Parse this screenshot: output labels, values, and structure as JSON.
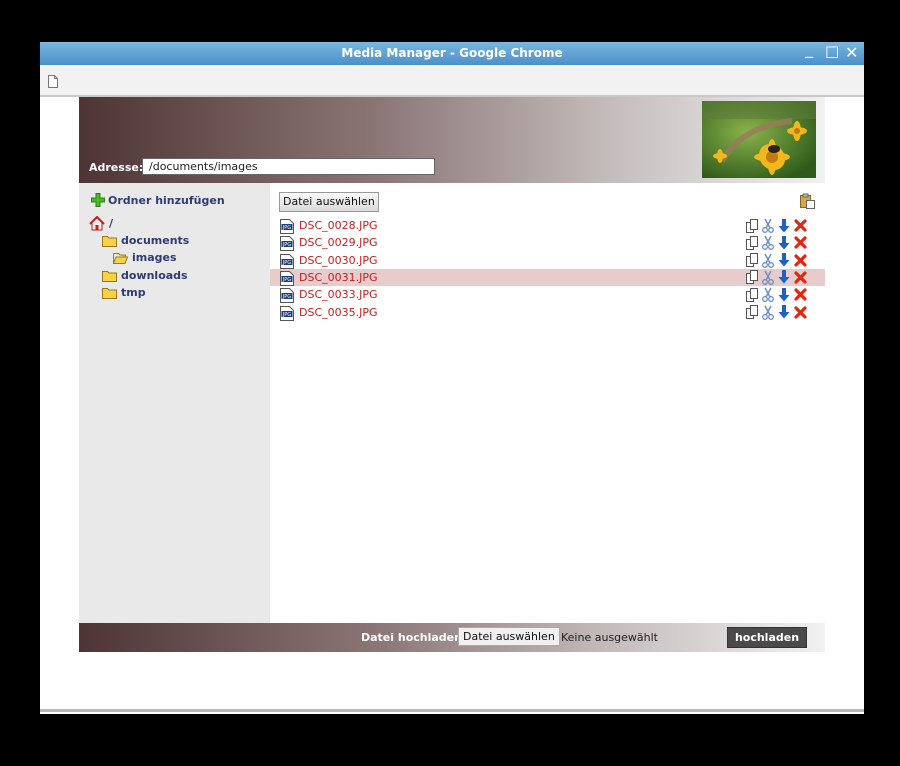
{
  "window": {
    "title": "Media Manager - Google Chrome",
    "min": "_",
    "max": "☐",
    "close": "✕"
  },
  "address": {
    "label": "Adresse:",
    "value": "/documents/images"
  },
  "sidebar": {
    "add_folder": "Ordner hinzufügen",
    "tree": [
      {
        "label": "/",
        "icon": "home-icon"
      },
      {
        "label": "documents",
        "icon": "folder-icon"
      },
      {
        "label": "images",
        "icon": "folder-open-icon"
      },
      {
        "label": "downloads",
        "icon": "folder-icon"
      },
      {
        "label": "tmp",
        "icon": "folder-icon"
      }
    ]
  },
  "main": {
    "choose_file": "Datei auswählen",
    "files": [
      "DSC_0028.JPG",
      "DSC_0029.JPG",
      "DSC_0030.JPG",
      "DSC_0031.JPG",
      "DSC_0033.JPG",
      "DSC_0035.JPG"
    ],
    "selected_index": 3
  },
  "footer": {
    "upload_label": "Datei hochladen:",
    "choose_file": "Datei auswählen",
    "no_file": "Keine ausgewählt",
    "upload_button": "hochladen"
  },
  "colors": {
    "file_link": "#c02020",
    "tree_text": "#2e3c72",
    "selected_row": "#e8cccc"
  }
}
